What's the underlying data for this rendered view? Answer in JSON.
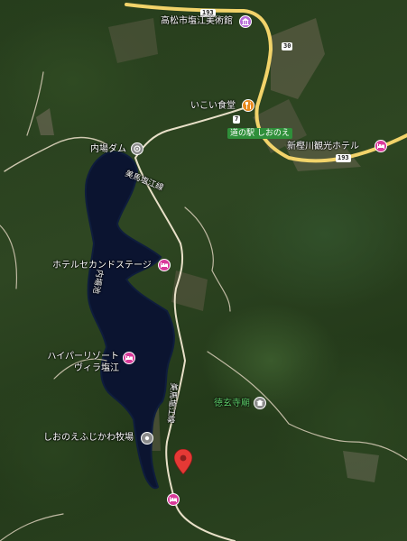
{
  "map": {
    "labels": {
      "museum": "高松市塩江美術館",
      "restaurant": "いこい食堂",
      "station": "道の駅 しおのえ",
      "hotel_shinsakugawa": "新樫川観光ホテル",
      "dam": "内場ダム",
      "road_east": "美馬塩江線",
      "hotel_second_stage": "ホテルセカンドステージ",
      "river_mark": "内場池",
      "resort_line1": "ハイパーリゾート",
      "resort_line2": "ヴィラ塩江",
      "road_south": "美馬塩江線",
      "temple": "徳玄寺廟",
      "ranch": "しおのえふじかわ牧場"
    },
    "route_shields": {
      "r193_top": "193",
      "r30": "30",
      "r7": "7",
      "r193_right": "193"
    },
    "colors": {
      "water": "#0b1430",
      "road": "#e8e0c8",
      "highway": "#f2d36a",
      "hotel_pin": "#d93a9a",
      "food_pin": "#e8891e",
      "selected_pin": "#e53935",
      "station_badge": "#2f8f3a"
    },
    "icons": {
      "museum": "museum-icon",
      "restaurant": "fork-knife-icon",
      "hotel": "bed-icon",
      "dam": "dam-icon",
      "temple": "temple-icon",
      "ranch": "pin-dot-icon",
      "selected": "location-pin-icon"
    }
  }
}
